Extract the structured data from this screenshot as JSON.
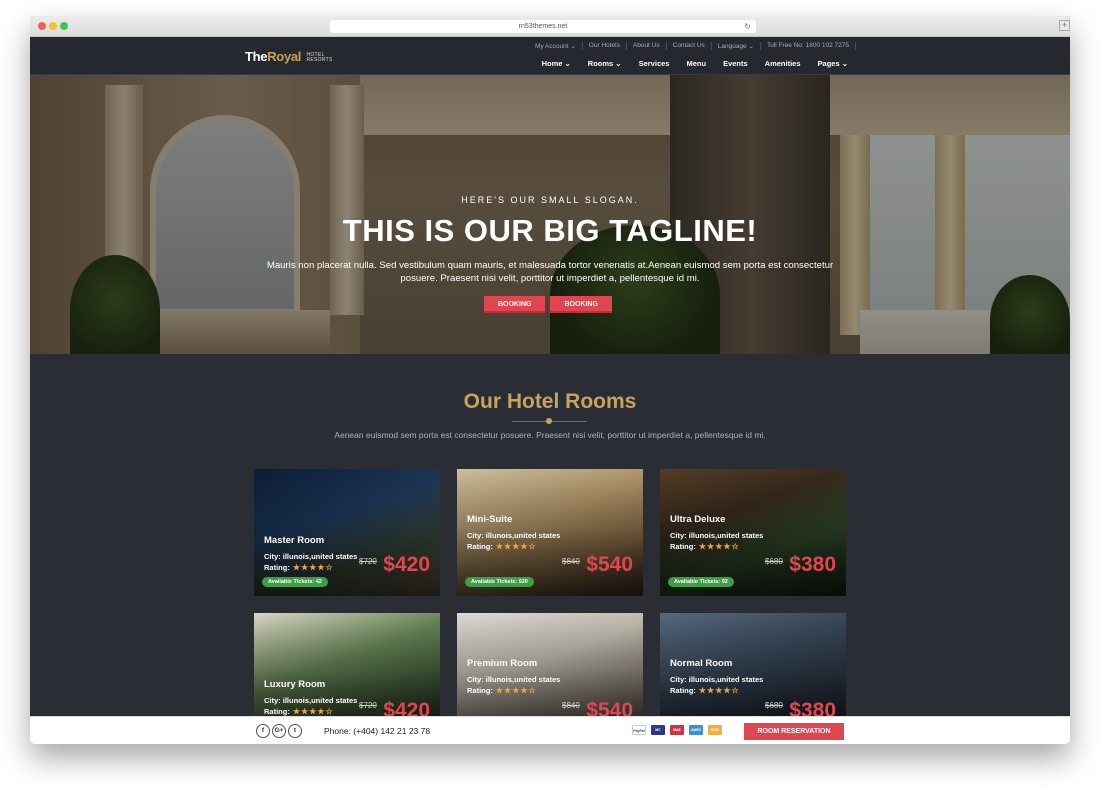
{
  "browser": {
    "url": "rn53themes.net",
    "reload_icon": "reload-icon",
    "new_tab_label": "+"
  },
  "header": {
    "logo": {
      "part1": "The",
      "part2": "Royal",
      "sub1": "HOTEL",
      "sub2": "RESORTS"
    },
    "top_nav": [
      {
        "label": "My Account ⌄"
      },
      {
        "label": "Our Hotels"
      },
      {
        "label": "About Us"
      },
      {
        "label": "Contact Us"
      },
      {
        "label": "Language ⌄"
      },
      {
        "label": "Toll Free No: 1800 102 7275"
      }
    ],
    "main_nav": [
      {
        "label": "Home ⌄"
      },
      {
        "label": "Rooms ⌄"
      },
      {
        "label": "Services"
      },
      {
        "label": "Menu"
      },
      {
        "label": "Events"
      },
      {
        "label": "Amenities"
      },
      {
        "label": "Pages ⌄"
      }
    ]
  },
  "hero": {
    "slogan": "HERE'S OUR SMALL SLOGAN.",
    "tagline": "THIS IS OUR BIG TAGLINE!",
    "text": "Mauris non placerat nulla. Sed vestibulum quam mauris, et malesuada tortor venenatis at.Aenean euismod sem porta est consectetur posuere. Praesent nisi velit, porttitor ut imperdiet a, pellentesque id mi.",
    "buttons": [
      "BOOKING",
      "BOOKING"
    ],
    "slides_total": 4,
    "active_slide": 3
  },
  "rooms_section": {
    "title": "Our Hotel Rooms",
    "subtitle": "Aenean euismod sem porta est consectetur posuere. Praesent nisi velit, porttitor ut imperdiet a, pellentesque id mi.",
    "rooms": [
      {
        "name": "Master Room",
        "city": "City: illunois,united states",
        "rating_label": "Rating:",
        "stars": "★★★★☆",
        "old_price": "$720",
        "price": "$420",
        "tickets": "Available Tickets: 42"
      },
      {
        "name": "Mini-Suite",
        "city": "City: illunois,united states",
        "rating_label": "Rating:",
        "stars": "★★★★☆",
        "old_price": "$840",
        "price": "$540",
        "tickets": "Available Tickets: 520"
      },
      {
        "name": "Ultra Deluxe",
        "city": "City: illunois,united states",
        "rating_label": "Rating:",
        "stars": "★★★★☆",
        "old_price": "$680",
        "price": "$380",
        "tickets": "Available Tickets: 92"
      },
      {
        "name": "Luxury Room",
        "city": "City: illunois,united states",
        "rating_label": "Rating:",
        "stars": "★★★★☆",
        "old_price": "$720",
        "price": "$420",
        "tickets": ""
      },
      {
        "name": "Premium Room",
        "city": "City: illunois,united states",
        "rating_label": "Rating:",
        "stars": "★★★★☆",
        "old_price": "$840",
        "price": "$540",
        "tickets": ""
      },
      {
        "name": "Normal Room",
        "city": "City: illunois,united states",
        "rating_label": "Rating:",
        "stars": "★★★★☆",
        "old_price": "$680",
        "price": "$380",
        "tickets": ""
      }
    ]
  },
  "footer": {
    "social": [
      "f",
      "G+",
      "t"
    ],
    "social_icons": [
      "facebook-icon",
      "google-plus-icon",
      "twitter-icon"
    ],
    "phone": "Phone: (+404) 142 21 23 78",
    "payment_icons": [
      "paypal-icon",
      "mastercard-icon",
      "maestro-icon",
      "amex-icon",
      "discover-icon"
    ],
    "payment_labels": [
      "PayPal",
      "MC",
      "MAE",
      "AMEX",
      "DISC"
    ],
    "reserve": "ROOM RESERVATION"
  },
  "colors": {
    "accent_red": "#e04650",
    "gold": "#c8a35a",
    "dark_bg": "#2b2d35",
    "ticket_green": "#3c9f45"
  }
}
